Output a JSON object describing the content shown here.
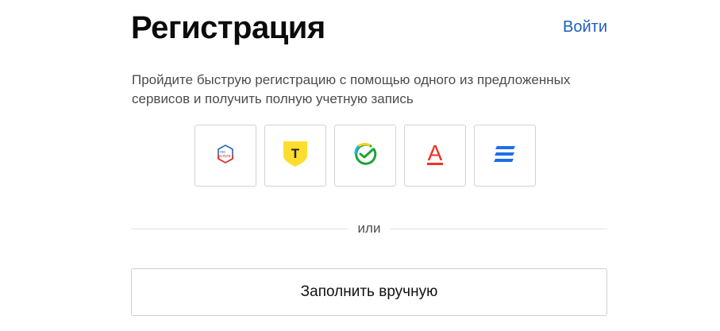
{
  "header": {
    "title": "Регистрация",
    "login_link": "Войти"
  },
  "intro": {
    "text": "Пройдите быструю регистрацию с помощью одного из предложенных сервисов и получить полную учетную запись"
  },
  "services": [
    {
      "icon": "gosuslugi-icon",
      "logo_line1": "гос",
      "logo_line2": "услуги"
    },
    {
      "icon": "tinkoff-icon",
      "logo_letter": "Т"
    },
    {
      "icon": "sber-icon"
    },
    {
      "icon": "alfa-bank-icon",
      "logo_letter": "А"
    },
    {
      "icon": "vtb-icon"
    }
  ],
  "divider": {
    "text": "или"
  },
  "manual": {
    "button_label": "Заполнить вручную"
  },
  "colors": {
    "link": "#1d5fb8",
    "title": "#0b0b0b",
    "text": "#4c4c4c",
    "border": "#d3d3d3",
    "tinkoff_yellow": "#ffdd2d",
    "alfa_red": "#ef3124",
    "vtb_blue": "#1f6ee8",
    "sber_green": "#21a038"
  }
}
